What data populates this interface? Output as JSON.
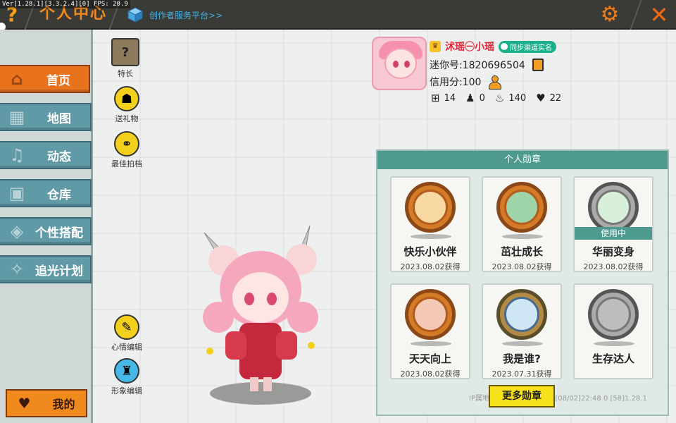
{
  "debug": "Ver[1.28.1][3.3.2.4][0] FPS: 20.9",
  "header": {
    "title": "个人中心",
    "creator_label": "创作者服务平台>>"
  },
  "sidebar": {
    "items": [
      {
        "label": "首页",
        "icon": "house-icon",
        "active": true
      },
      {
        "label": "地图",
        "icon": "map-icon"
      },
      {
        "label": "动态",
        "icon": "bell-icon"
      },
      {
        "label": "仓库",
        "icon": "warehouse-icon"
      },
      {
        "label": "个性搭配",
        "icon": "shirt-icon"
      },
      {
        "label": "追光计划",
        "icon": "spotlight-icon"
      }
    ],
    "mine_label": "我的"
  },
  "tools": {
    "specialty": "特长",
    "gift": "送礼物",
    "partner": "最佳拍档",
    "mood": "心情编辑",
    "look": "形象编辑"
  },
  "profile": {
    "name": "沭瑶㊀小瑶",
    "verify": "同步渠道实名",
    "mini_id": "迷你号:1820696504",
    "credit": "信用分:100",
    "stats": {
      "plus": "14",
      "followers": "0",
      "fire": "140",
      "likes": "22"
    }
  },
  "badges": {
    "title": "个人勋章",
    "items": [
      {
        "name": "快乐小伙伴",
        "date": "2023.08.02获得",
        "style": "bronze"
      },
      {
        "name": "茁壮成长",
        "date": "2023.08.02获得",
        "style": "bronze"
      },
      {
        "name": "华丽变身",
        "date": "2023.08.02获得",
        "style": "silver",
        "in_use": "使用中"
      },
      {
        "name": "天天向上",
        "date": "2023.08.02获得",
        "style": "bronze"
      },
      {
        "name": "我是谁?",
        "date": "2023.07.31获得",
        "style": "blue"
      },
      {
        "name": "生存达人",
        "date": "",
        "style": "silver"
      }
    ],
    "more_label": "更多勋章"
  },
  "footer": {
    "ip_line": "IP属地:上海 1820696504 [08/02]22:48 0 [58]1.28.1"
  }
}
